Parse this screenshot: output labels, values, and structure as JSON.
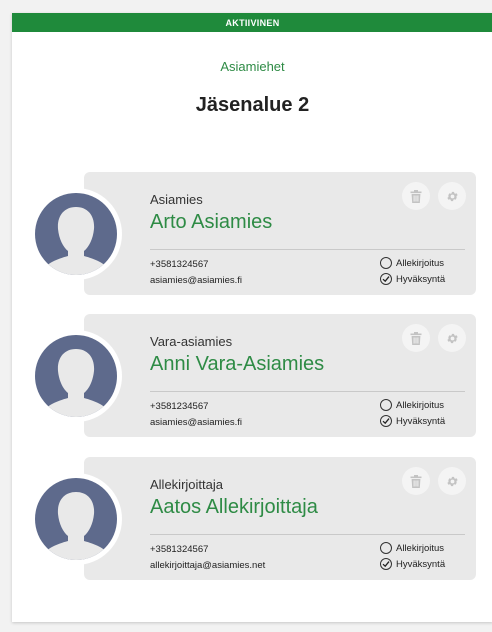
{
  "status": {
    "label": "AKTIIVINEN"
  },
  "section": {
    "subtitle": "Asiamiehet",
    "title": "Jäsenalue 2"
  },
  "cards": [
    {
      "role": "Asiamies",
      "name": "Arto Asiamies",
      "phone": "+3581324567",
      "email": "asiamies@asiamies.fi",
      "sign_label": "Allekirjoitus",
      "approve_label": "Hyväksyntä",
      "sign_checked": false,
      "approve_checked": true
    },
    {
      "role": "Vara-asiamies",
      "name": "Anni Vara-Asiamies",
      "phone": "+3581234567",
      "email": "asiamies@asiamies.fi",
      "sign_label": "Allekirjoitus",
      "approve_label": "Hyväksyntä",
      "sign_checked": false,
      "approve_checked": true
    },
    {
      "role": "Allekirjoittaja",
      "name": "Aatos Allekirjoittaja",
      "phone": "+3581324567",
      "email": "allekirjoittaja@asiamies.net",
      "sign_label": "Allekirjoitus",
      "approve_label": "Hyväksyntä",
      "sign_checked": false,
      "approve_checked": true
    }
  ],
  "icons": {
    "avatar": "person-silhouette-icon",
    "delete": "trash-icon",
    "settings": "gear-icon",
    "unchecked": "circle-icon",
    "checked": "check-circle-icon"
  },
  "colors": {
    "status_bar": "#1f8a3b",
    "accent": "#2e8b45",
    "avatar_bg": "#5e6a8c",
    "card_bg": "#e9e9e9"
  }
}
